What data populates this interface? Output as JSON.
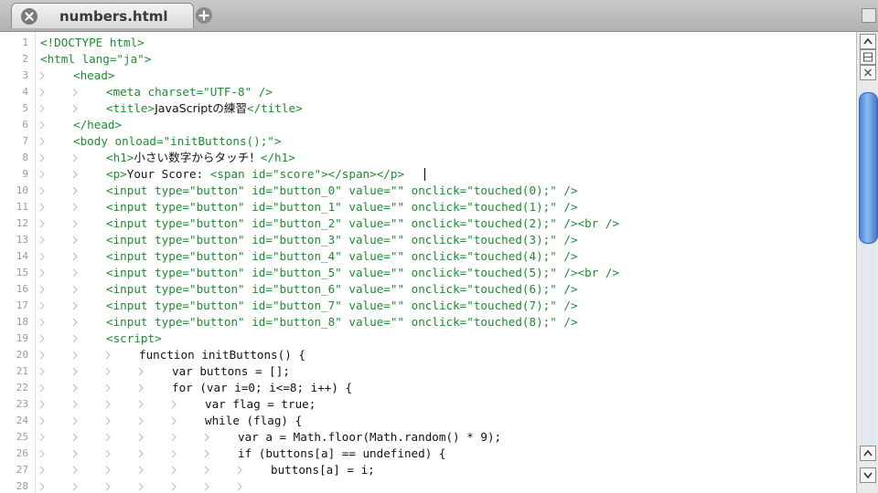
{
  "tab": {
    "title": "numbers.html",
    "close_icon": "close-icon",
    "add_icon": "add-tab-icon"
  },
  "editor": {
    "lines": [
      {
        "n": "1",
        "indent": 0,
        "parts": [
          {
            "c": "tag",
            "t": "<!DOCTYPE html>"
          }
        ]
      },
      {
        "n": "2",
        "indent": 0,
        "parts": [
          {
            "c": "tag",
            "t": "<html lang=\"ja\">"
          }
        ]
      },
      {
        "n": "3",
        "indent": 1,
        "parts": [
          {
            "c": "tag",
            "t": "<head>"
          }
        ]
      },
      {
        "n": "4",
        "indent": 2,
        "parts": [
          {
            "c": "tag",
            "t": "<meta charset=\"UTF-8\" />"
          }
        ]
      },
      {
        "n": "5",
        "indent": 2,
        "parts": [
          {
            "c": "tag",
            "t": "<title>"
          },
          {
            "c": "jp",
            "t": "JavaScriptの練習"
          },
          {
            "c": "tag",
            "t": "</title>"
          }
        ]
      },
      {
        "n": "6",
        "indent": 1,
        "parts": [
          {
            "c": "tag",
            "t": "</head>"
          }
        ]
      },
      {
        "n": "7",
        "indent": 1,
        "parts": [
          {
            "c": "tag",
            "t": "<body onload=\"initButtons();\">"
          }
        ]
      },
      {
        "n": "8",
        "indent": 2,
        "parts": [
          {
            "c": "tag",
            "t": "<h1>"
          },
          {
            "c": "jp",
            "t": "小さい数字からタッチ！"
          },
          {
            "c": "tag",
            "t": "</h1>"
          }
        ]
      },
      {
        "n": "9",
        "indent": 2,
        "parts": [
          {
            "c": "tag",
            "t": "<p>"
          },
          {
            "c": "plain",
            "t": "Your Score: "
          },
          {
            "c": "tag",
            "t": "<span id=\"score\"></span></p>"
          }
        ]
      },
      {
        "n": "10",
        "indent": 2,
        "parts": [
          {
            "c": "tag",
            "t": "<input type=\"button\" id=\"button_0\" value=\"\" onclick=\"touched(0);\" />"
          }
        ]
      },
      {
        "n": "11",
        "indent": 2,
        "parts": [
          {
            "c": "tag",
            "t": "<input type=\"button\" id=\"button_1\" value=\"\" onclick=\"touched(1);\" />"
          }
        ]
      },
      {
        "n": "12",
        "indent": 2,
        "parts": [
          {
            "c": "tag",
            "t": "<input type=\"button\" id=\"button_2\" value=\"\" onclick=\"touched(2);\" /><br />"
          }
        ]
      },
      {
        "n": "13",
        "indent": 2,
        "parts": [
          {
            "c": "tag",
            "t": "<input type=\"button\" id=\"button_3\" value=\"\" onclick=\"touched(3);\" />"
          }
        ]
      },
      {
        "n": "14",
        "indent": 2,
        "parts": [
          {
            "c": "tag",
            "t": "<input type=\"button\" id=\"button_4\" value=\"\" onclick=\"touched(4);\" />"
          }
        ]
      },
      {
        "n": "15",
        "indent": 2,
        "parts": [
          {
            "c": "tag",
            "t": "<input type=\"button\" id=\"button_5\" value=\"\" onclick=\"touched(5);\" /><br />"
          }
        ]
      },
      {
        "n": "16",
        "indent": 2,
        "parts": [
          {
            "c": "tag",
            "t": "<input type=\"button\" id=\"button_6\" value=\"\" onclick=\"touched(6);\" />"
          }
        ]
      },
      {
        "n": "17",
        "indent": 2,
        "parts": [
          {
            "c": "tag",
            "t": "<input type=\"button\" id=\"button_7\" value=\"\" onclick=\"touched(7);\" />"
          }
        ]
      },
      {
        "n": "18",
        "indent": 2,
        "parts": [
          {
            "c": "tag",
            "t": "<input type=\"button\" id=\"button_8\" value=\"\" onclick=\"touched(8);\" />"
          }
        ]
      },
      {
        "n": "19",
        "indent": 2,
        "parts": [
          {
            "c": "tag",
            "t": "<script>"
          }
        ]
      },
      {
        "n": "20",
        "indent": 3,
        "parts": [
          {
            "c": "plain",
            "t": "function initButtons() {"
          }
        ]
      },
      {
        "n": "21",
        "indent": 4,
        "parts": [
          {
            "c": "plain",
            "t": "var buttons = [];"
          }
        ]
      },
      {
        "n": "22",
        "indent": 4,
        "parts": [
          {
            "c": "plain",
            "t": "for (var i=0; i<=8; i++) {"
          }
        ]
      },
      {
        "n": "23",
        "indent": 5,
        "parts": [
          {
            "c": "plain",
            "t": "var flag = true;"
          }
        ]
      },
      {
        "n": "24",
        "indent": 5,
        "parts": [
          {
            "c": "plain",
            "t": "while (flag) {"
          }
        ]
      },
      {
        "n": "25",
        "indent": 6,
        "parts": [
          {
            "c": "plain",
            "t": "var a = Math.floor(Math.random() * 9);"
          }
        ]
      },
      {
        "n": "26",
        "indent": 6,
        "parts": [
          {
            "c": "plain",
            "t": "if (buttons[a] == undefined) {"
          }
        ]
      },
      {
        "n": "27",
        "indent": 7,
        "parts": [
          {
            "c": "plain",
            "t": "buttons[a] = i;"
          }
        ]
      },
      {
        "n": "28",
        "indent": 7,
        "parts": []
      }
    ]
  },
  "colors": {
    "tag": "#1f8a2f",
    "text": "#111111",
    "scroll_thumb": "#5b93dc"
  }
}
